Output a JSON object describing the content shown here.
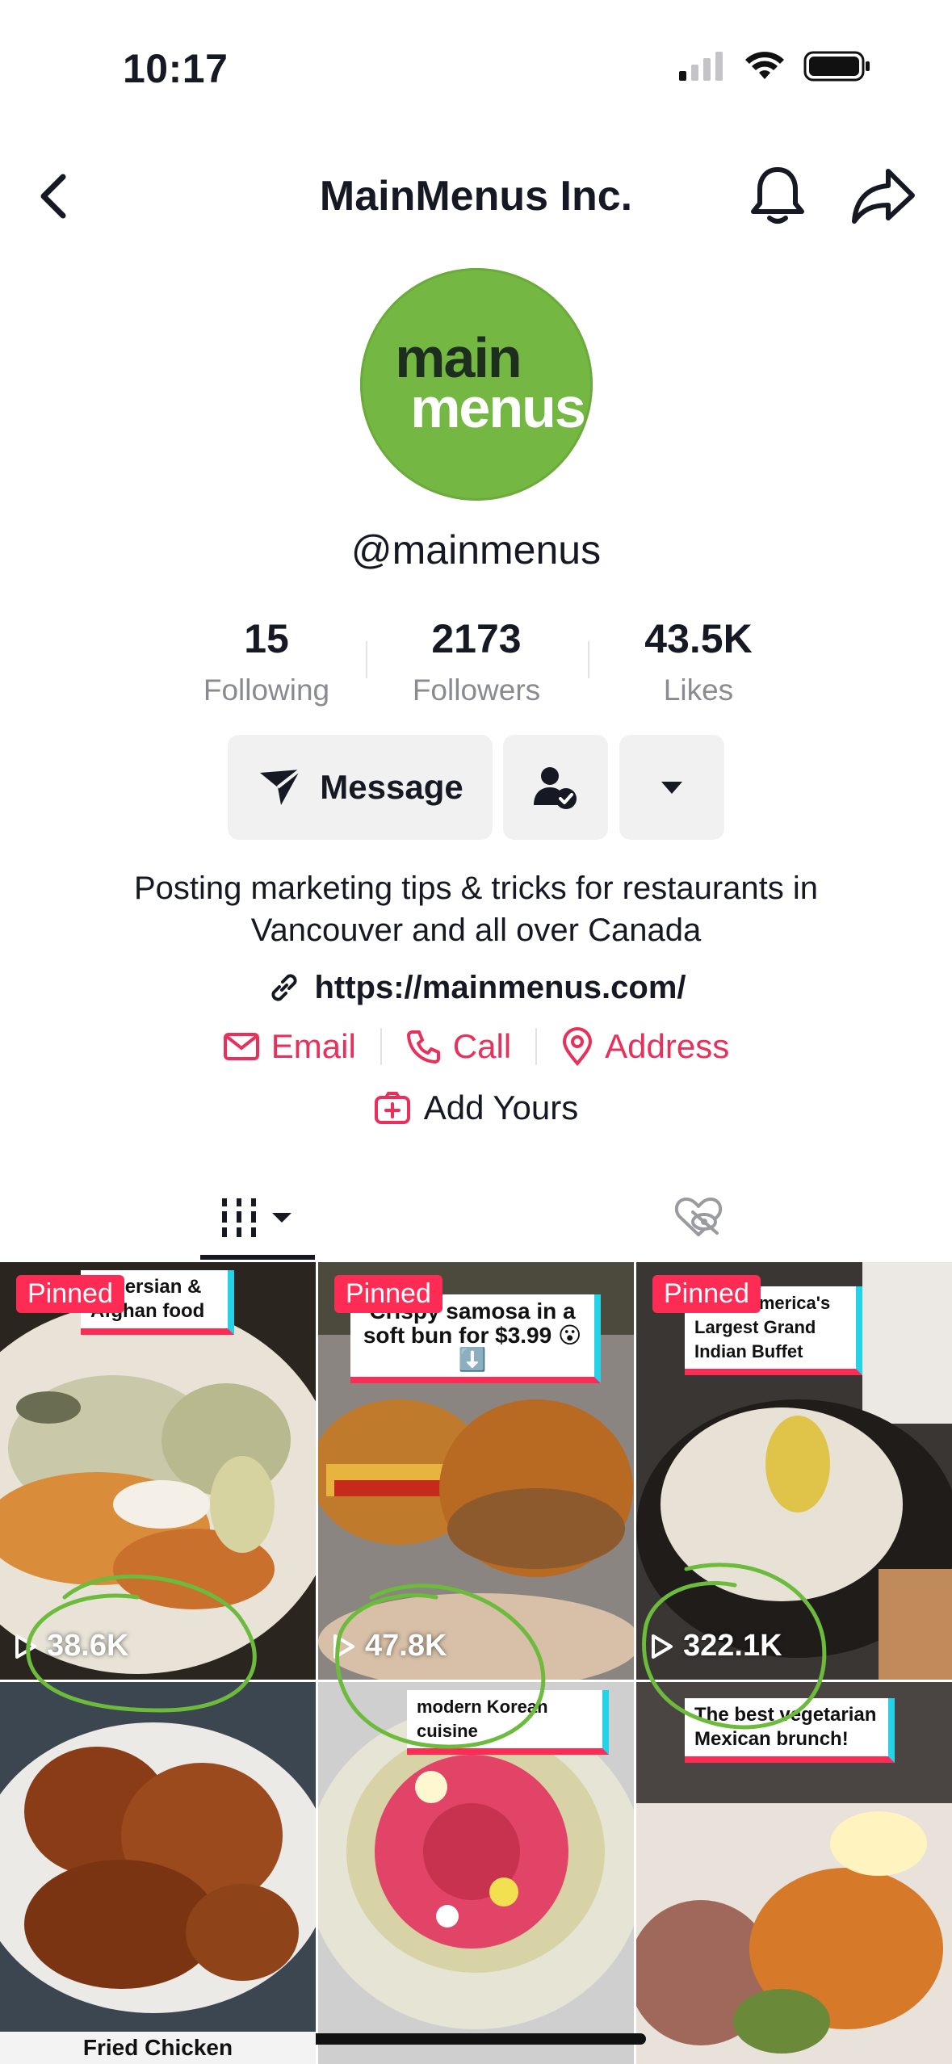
{
  "status_bar": {
    "time": "10:17"
  },
  "nav": {
    "title": "MainMenus Inc."
  },
  "profile": {
    "avatar_line1": "main",
    "avatar_line2": "menus",
    "username": "@mainmenus",
    "stats": [
      {
        "value": "15",
        "label": "Following"
      },
      {
        "value": "2173",
        "label": "Followers"
      },
      {
        "value": "43.5K",
        "label": "Likes"
      }
    ],
    "message_label": "Message",
    "bio_line1": "Posting marketing tips & tricks for restaurants in",
    "bio_line2": "Vancouver and all over Canada",
    "link": "https://mainmenus.com/",
    "contacts": {
      "email": "Email",
      "call": "Call",
      "address": "Address"
    },
    "add_yours": "Add Yours"
  },
  "colors": {
    "accent": "#fe2c55",
    "contact": "#e8305a",
    "brand_green": "#74b843",
    "annotation": "#6cbb3c"
  },
  "videos": [
    {
      "pinned": "Pinned",
      "caption": "al Persian & Afghan food",
      "views": "38.6K"
    },
    {
      "pinned": "Pinned",
      "caption": "Crispy samosa in a soft bun for $3.99 😮⬇️",
      "views": "47.8K"
    },
    {
      "pinned": "Pinned",
      "caption": "North America's Largest Grand Indian Buffet",
      "views": "322.1K"
    },
    {
      "caption": "Fried Chicken"
    },
    {
      "caption": "modern Korean cuisine"
    },
    {
      "caption": "The best vegetarian Mexican brunch!"
    }
  ]
}
